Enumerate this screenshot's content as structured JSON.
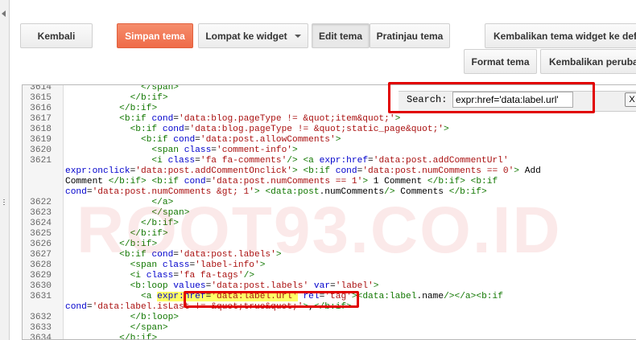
{
  "toolbar": {
    "back_label": "Kembali",
    "save_label": "Simpan tema",
    "jump_label": "Lompat ke widget",
    "edit_label": "Edit tema",
    "preview_label": "Pratinjau tema",
    "restore_widgets_label": "Kembalikan tema widget ke default",
    "format_label": "Format tema",
    "revert_label": "Kembalikan perubahan"
  },
  "search": {
    "label": "Search:",
    "value": "expr:href='data:label.url'",
    "close": "X"
  },
  "watermark": "ROOT93.CO.ID",
  "colors": {
    "accent": "#ef6b48",
    "highlight_box": "#e10000",
    "match_highlight": "#ffff66",
    "tag": "#117700",
    "attribute": "#0000cc",
    "string": "#aa1111"
  },
  "code": {
    "line_numbers": [
      "3614",
      "3615",
      "3616",
      "3617",
      "3618",
      "3619",
      "3620",
      "3621",
      "",
      "",
      "",
      "3622",
      "3623",
      "3624",
      "3625",
      "3626",
      "3627",
      "3628",
      "3629",
      "3630",
      "3631",
      "",
      "3632",
      "3633",
      "3634"
    ],
    "lines": [
      "              </span>",
      "            </b:if>",
      "          </b:if>",
      "          <b:if cond='data:blog.pageType != &quot;item&quot;'>",
      "            <b:if cond='data:blog.pageType != &quot;static_page&quot;'>",
      "              <b:if cond='data:post.allowComments'>",
      "                <span class='comment-info'>",
      "                <i class='fa fa-comments'/> <a expr:href='data:post.addCommentUrl'",
      "expr:onclick='data:post.addCommentOnclick'> <b:if cond='data:post.numComments == 0'> Add",
      "Comment </b:if> <b:if cond='data:post.numComments == 1'> 1 Comment </b:if> <b:if",
      "cond='data:post.numComments &gt; 1'> <data:post.numComments/> Comments </b:if>",
      "                </a>",
      "                </span>",
      "              </b:if>",
      "            </b:if>",
      "          </b:if>",
      "          <b:if cond='data:post.labels'>",
      "            <span class='label-info'>",
      "            <i class='fa fa-tags'/>",
      "            <b:loop values='data:post.labels' var='label'>",
      "              <a expr:href='data:label.url' rel='tag'><data:label.name/></a><b:if",
      "cond='data:label.isLast != &quot;true&quot;'>,</b:if>",
      "            </b:loop>",
      "            </span>",
      "          </b:if>"
    ]
  }
}
